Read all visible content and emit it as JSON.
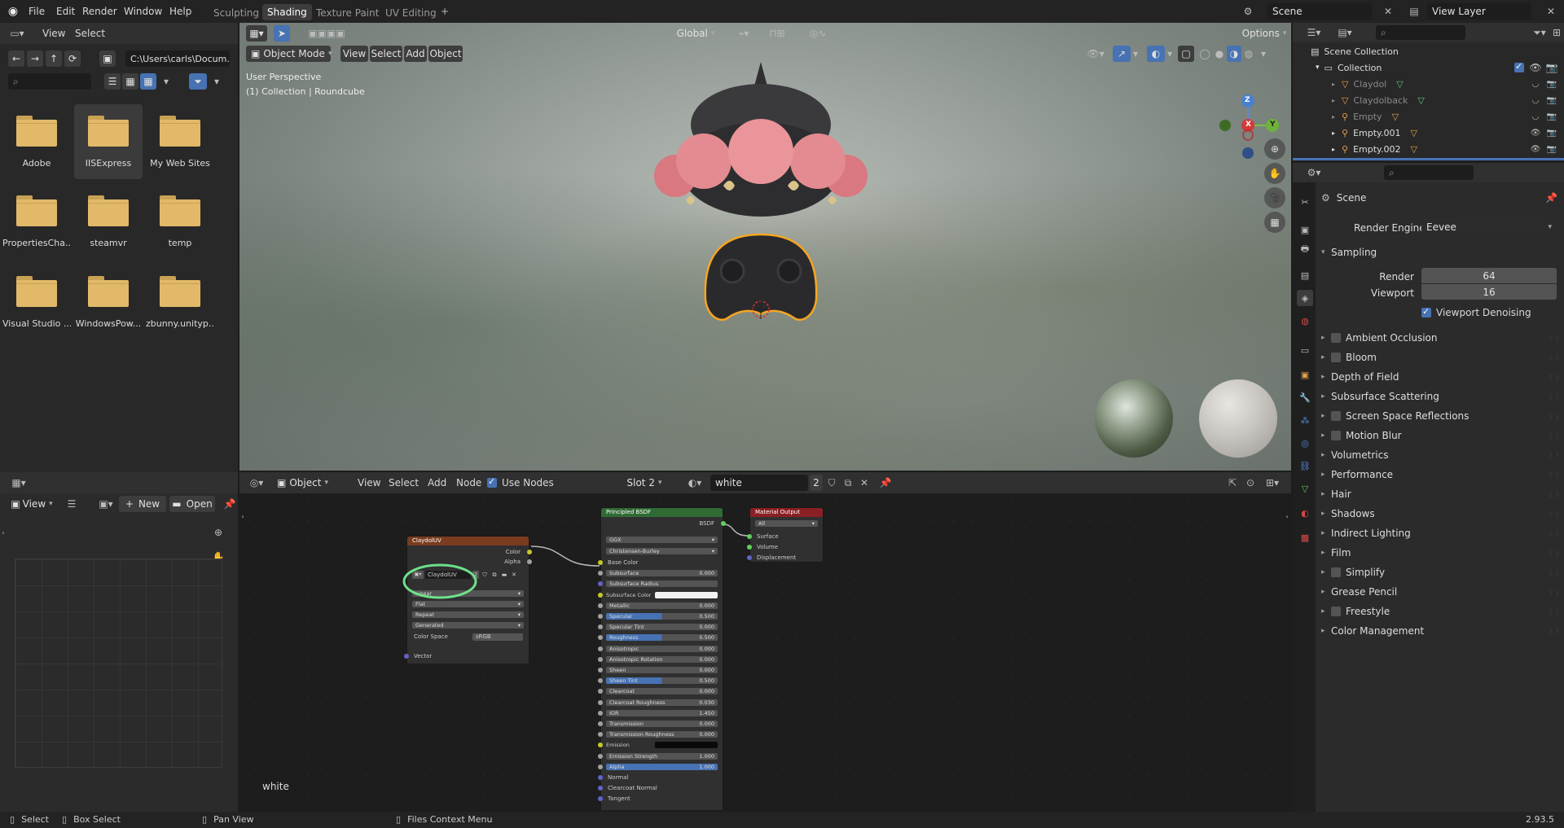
{
  "topbar": {
    "menus": [
      "File",
      "Edit",
      "Render",
      "Window",
      "Help"
    ],
    "workspaces": [
      "Sculpting",
      "Shading",
      "Texture Paint",
      "UV Editing"
    ],
    "active_workspace": "Shading",
    "scene": "Scene",
    "view_layer": "View Layer"
  },
  "file_browser": {
    "menus": [
      "View",
      "Select"
    ],
    "path": "C:\\Users\\carls\\Docum...",
    "items": [
      "Adobe",
      "IISExpress",
      "My Web Sites",
      "PropertiesCha...",
      "steamvr",
      "temp",
      "Visual Studio ...",
      "WindowsPow...",
      "zbunny.unityp..."
    ],
    "selected": "IISExpress"
  },
  "viewport": {
    "mode": "Object Mode",
    "menus": [
      "View",
      "Select",
      "Add",
      "Object"
    ],
    "transform": "Global",
    "options": "Options",
    "info_line1": "User Perspective",
    "info_line2": "(1) Collection | Roundcube",
    "axis_z": "Z",
    "axis_x": "X",
    "axis_y": "Y"
  },
  "image_editor": {
    "view": "View",
    "new": "New",
    "open": "Open"
  },
  "node_editor": {
    "object": "Object",
    "menus": [
      "View",
      "Select",
      "Add",
      "Node"
    ],
    "use_nodes": "Use Nodes",
    "slot": "Slot 2",
    "material": "white",
    "users": "2",
    "label": "white",
    "image_node": {
      "title": "ClaydolUV",
      "out_color": "Color",
      "out_alpha": "Alpha",
      "image": "ClaydolUV",
      "image_users": "2",
      "interpolation": "Linear",
      "projection": "Flat",
      "extension": "Repeat",
      "source": "Generated",
      "color_space_label": "Color Space",
      "color_space": "sRGB",
      "vector": "Vector"
    },
    "bsdf_node": {
      "title": "Principled BSDF",
      "output": "BSDF",
      "distribution": "GGX",
      "subsurface_method": "Christensen-Burley",
      "rows": [
        {
          "label": "Base Color",
          "value": "",
          "kind": "socket"
        },
        {
          "label": "Subsurface",
          "value": "0.000",
          "kind": "field"
        },
        {
          "label": "Subsurface Radius",
          "value": "",
          "kind": "dropdown"
        },
        {
          "label": "Subsurface Color",
          "value": "",
          "kind": "color"
        },
        {
          "label": "Metallic",
          "value": "0.000",
          "kind": "field"
        },
        {
          "label": "Specular",
          "value": "0.500",
          "kind": "bar"
        },
        {
          "label": "Specular Tint",
          "value": "0.000",
          "kind": "field"
        },
        {
          "label": "Roughness",
          "value": "0.500",
          "kind": "bar"
        },
        {
          "label": "Anisotropic",
          "value": "0.000",
          "kind": "field"
        },
        {
          "label": "Anisotropic Rotation",
          "value": "0.000",
          "kind": "field"
        },
        {
          "label": "Sheen",
          "value": "0.000",
          "kind": "field"
        },
        {
          "label": "Sheen Tint",
          "value": "0.500",
          "kind": "bar"
        },
        {
          "label": "Clearcoat",
          "value": "0.000",
          "kind": "field"
        },
        {
          "label": "Clearcoat Roughness",
          "value": "0.030",
          "kind": "field"
        },
        {
          "label": "IOR",
          "value": "1.450",
          "kind": "field"
        },
        {
          "label": "Transmission",
          "value": "0.000",
          "kind": "field"
        },
        {
          "label": "Transmission Roughness",
          "value": "0.000",
          "kind": "field"
        },
        {
          "label": "Emission",
          "value": "",
          "kind": "black"
        },
        {
          "label": "Emission Strength",
          "value": "1.000",
          "kind": "field"
        },
        {
          "label": "Alpha",
          "value": "1.000",
          "kind": "full"
        },
        {
          "label": "Normal",
          "value": "",
          "kind": "socket"
        },
        {
          "label": "Clearcoat Normal",
          "value": "",
          "kind": "socket"
        },
        {
          "label": "Tangent",
          "value": "",
          "kind": "socket"
        }
      ]
    },
    "output_node": {
      "title": "Material Output",
      "target": "All",
      "inputs": [
        "Surface",
        "Volume",
        "Displacement"
      ]
    }
  },
  "outliner": {
    "root": "Scene Collection",
    "collection": "Collection",
    "items": [
      "Claydol",
      "Claydolback",
      "Empty",
      "Empty.001",
      "Empty.002"
    ]
  },
  "properties": {
    "context": "Scene",
    "render_engine_label": "Render Engine",
    "render_engine": "Eevee",
    "sampling": "Sampling",
    "render_label": "Render",
    "render_value": "64",
    "viewport_label": "Viewport",
    "viewport_value": "16",
    "denoise": "Viewport Denoising",
    "panels": [
      {
        "label": "Ambient Occlusion",
        "check": true
      },
      {
        "label": "Bloom",
        "check": true
      },
      {
        "label": "Depth of Field",
        "check": false
      },
      {
        "label": "Subsurface Scattering",
        "check": false
      },
      {
        "label": "Screen Space Reflections",
        "check": true
      },
      {
        "label": "Motion Blur",
        "check": true
      },
      {
        "label": "Volumetrics",
        "check": false
      },
      {
        "label": "Performance",
        "check": false
      },
      {
        "label": "Hair",
        "check": false
      },
      {
        "label": "Shadows",
        "check": false
      },
      {
        "label": "Indirect Lighting",
        "check": false
      },
      {
        "label": "Film",
        "check": false
      },
      {
        "label": "Simplify",
        "check": true
      },
      {
        "label": "Grease Pencil",
        "check": false
      },
      {
        "label": "Freestyle",
        "check": true
      },
      {
        "label": "Color Management",
        "check": false
      }
    ]
  },
  "statusbar": {
    "select": "Select",
    "box_select": "Box Select",
    "pan_view": "Pan View",
    "context_menu": "Files Context Menu",
    "version": "2.93.5"
  },
  "colors": {
    "accent": "#4772b3",
    "selection_outline": "#f5a623",
    "annotation": "#6ee08a",
    "image_node_header": "#7a3b1f",
    "bsdf_node_header": "#2f6b33",
    "output_node_header": "#8a1f24"
  }
}
